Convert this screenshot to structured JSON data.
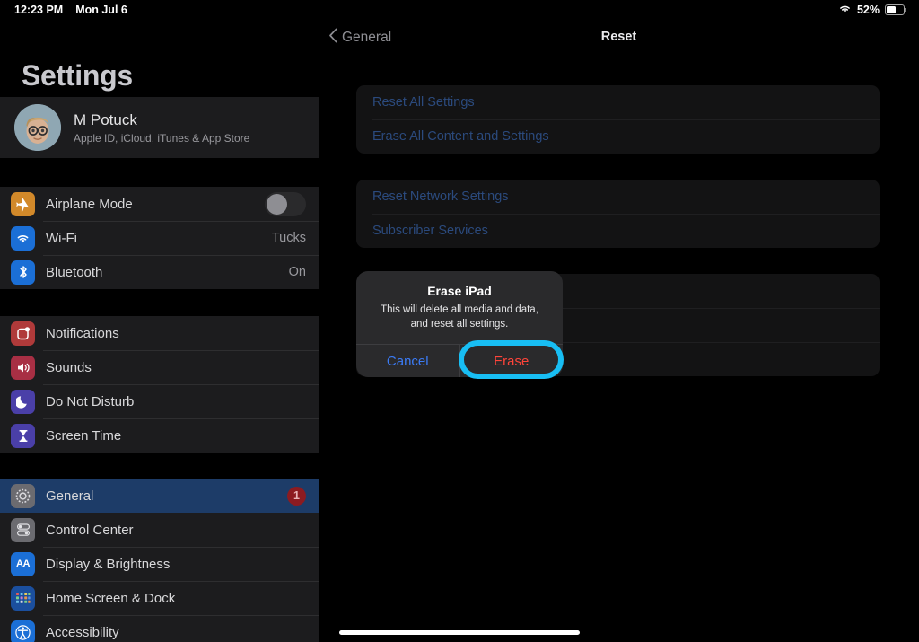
{
  "status_bar": {
    "time": "12:23 PM",
    "date": "Mon Jul 6",
    "wifi_icon": "wifi-icon",
    "battery_percent": "52%",
    "battery_level": 52
  },
  "sidebar": {
    "title": "Settings",
    "account": {
      "name": "M Potuck",
      "subtitle": "Apple ID, iCloud, iTunes & App Store",
      "avatar_icon": "memoji-avatar"
    },
    "groups": [
      {
        "items": [
          {
            "label": "Airplane Mode",
            "icon": "airplane-icon",
            "icon_color": "#d2892a",
            "control": "toggle",
            "toggle_on": false
          },
          {
            "label": "Wi-Fi",
            "icon": "wifi-icon",
            "icon_color": "#1b6fd6",
            "value": "Tucks"
          },
          {
            "label": "Bluetooth",
            "icon": "bluetooth-icon",
            "icon_color": "#1b6fd6",
            "value": "On"
          }
        ]
      },
      {
        "items": [
          {
            "label": "Notifications",
            "icon": "notifications-icon",
            "icon_color": "#b03a3a"
          },
          {
            "label": "Sounds",
            "icon": "sounds-icon",
            "icon_color": "#a82f44"
          },
          {
            "label": "Do Not Disturb",
            "icon": "moon-icon",
            "icon_color": "#4a3fa8"
          },
          {
            "label": "Screen Time",
            "icon": "hourglass-icon",
            "icon_color": "#4a3fa8"
          }
        ]
      },
      {
        "items": [
          {
            "label": "General",
            "icon": "gear-icon",
            "icon_color": "#6b6b70",
            "badge": "1",
            "selected": true
          },
          {
            "label": "Control Center",
            "icon": "control-center-icon",
            "icon_color": "#6b6b70"
          },
          {
            "label": "Display & Brightness",
            "icon": "display-brightness-icon",
            "icon_color": "#1b6fd6"
          },
          {
            "label": "Home Screen & Dock",
            "icon": "home-screen-dock-icon",
            "icon_color": "#1b4f9e"
          },
          {
            "label": "Accessibility",
            "icon": "accessibility-icon",
            "icon_color": "#1b6fd6"
          }
        ]
      }
    ]
  },
  "detail": {
    "back_label": "General",
    "back_icon": "chevron-left-icon",
    "title": "Reset",
    "cards": [
      {
        "rows": [
          {
            "label": "Reset All Settings"
          },
          {
            "label": "Erase All Content and Settings"
          }
        ]
      },
      {
        "rows": [
          {
            "label": "Reset Network Settings"
          },
          {
            "label": "Subscriber Services"
          }
        ]
      },
      {
        "rows": [
          {
            "label": ""
          },
          {
            "label": ""
          },
          {
            "label": ""
          }
        ]
      }
    ]
  },
  "alert": {
    "title": "Erase iPad",
    "message": "This will delete all media and data, and reset all settings.",
    "cancel_label": "Cancel",
    "confirm_label": "Erase",
    "cancel_color": "#3b7bf5",
    "confirm_color": "#ff443a",
    "highlight_color": "#18bef4"
  }
}
